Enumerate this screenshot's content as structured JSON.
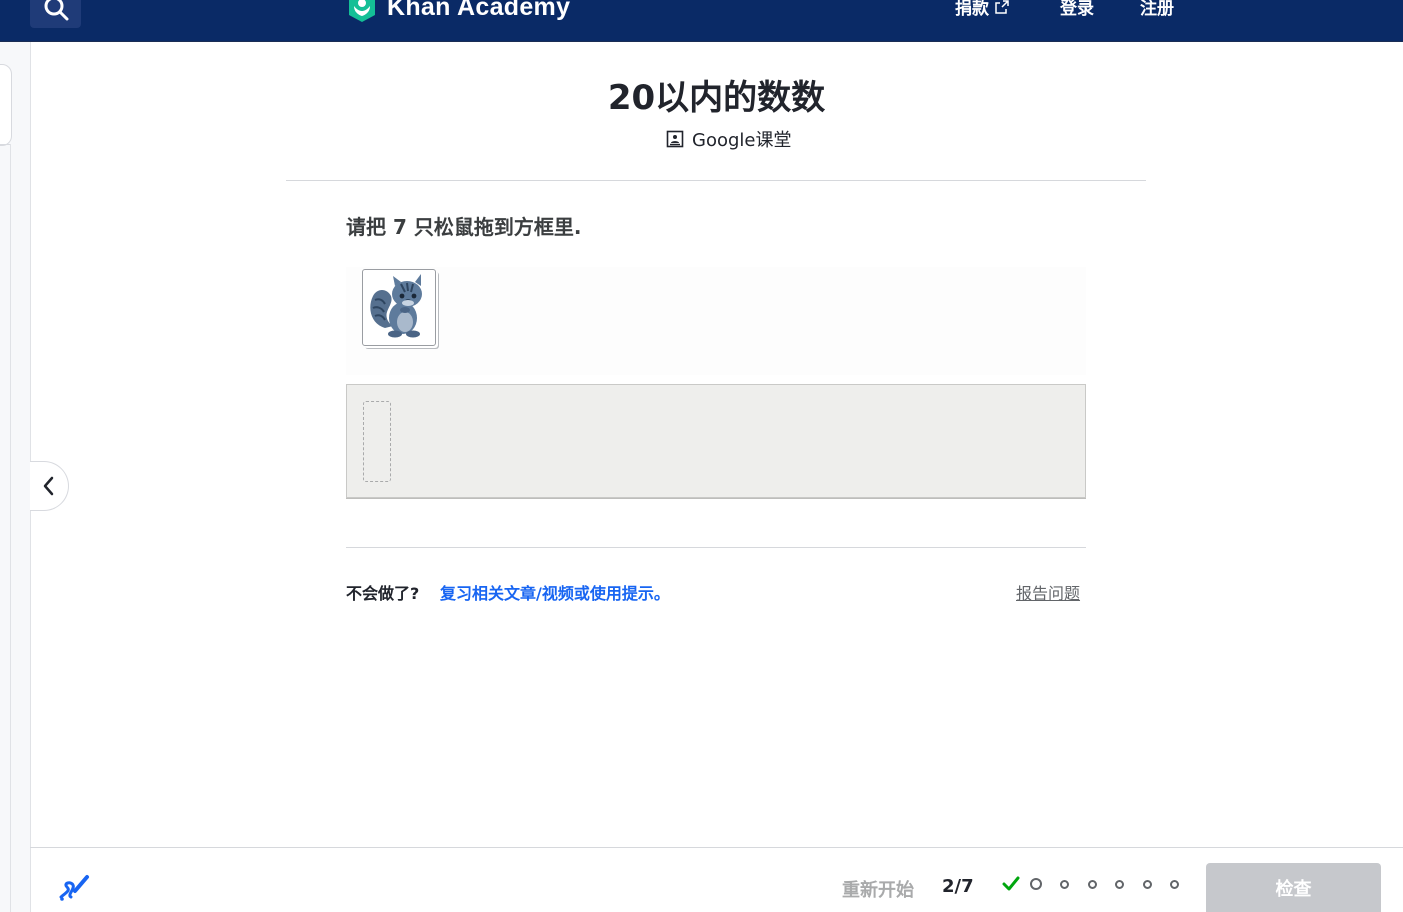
{
  "nav": {
    "logo_text": "Khan Academy",
    "donate": "捐款",
    "login": "登录",
    "signup": "注册"
  },
  "header": {
    "title": "20以内的数数",
    "classroom": "Google课堂"
  },
  "question": {
    "prompt": "请把 7 只松鼠拖到方框里.",
    "draggable_icon": "squirrel-icon"
  },
  "help": {
    "stuck": "不会做了?",
    "hint_link": "复习相关文章/视频或使用提示。",
    "report": "报告问题"
  },
  "footer": {
    "restart": "重新开始",
    "progress": "2/7",
    "check": "检查"
  },
  "colors": {
    "topbar": "#0a2a66",
    "link": "#1865f2",
    "check_green": "#00a60e",
    "disabled_button": "#c6c8cc",
    "squirrel": "#5a7594"
  }
}
